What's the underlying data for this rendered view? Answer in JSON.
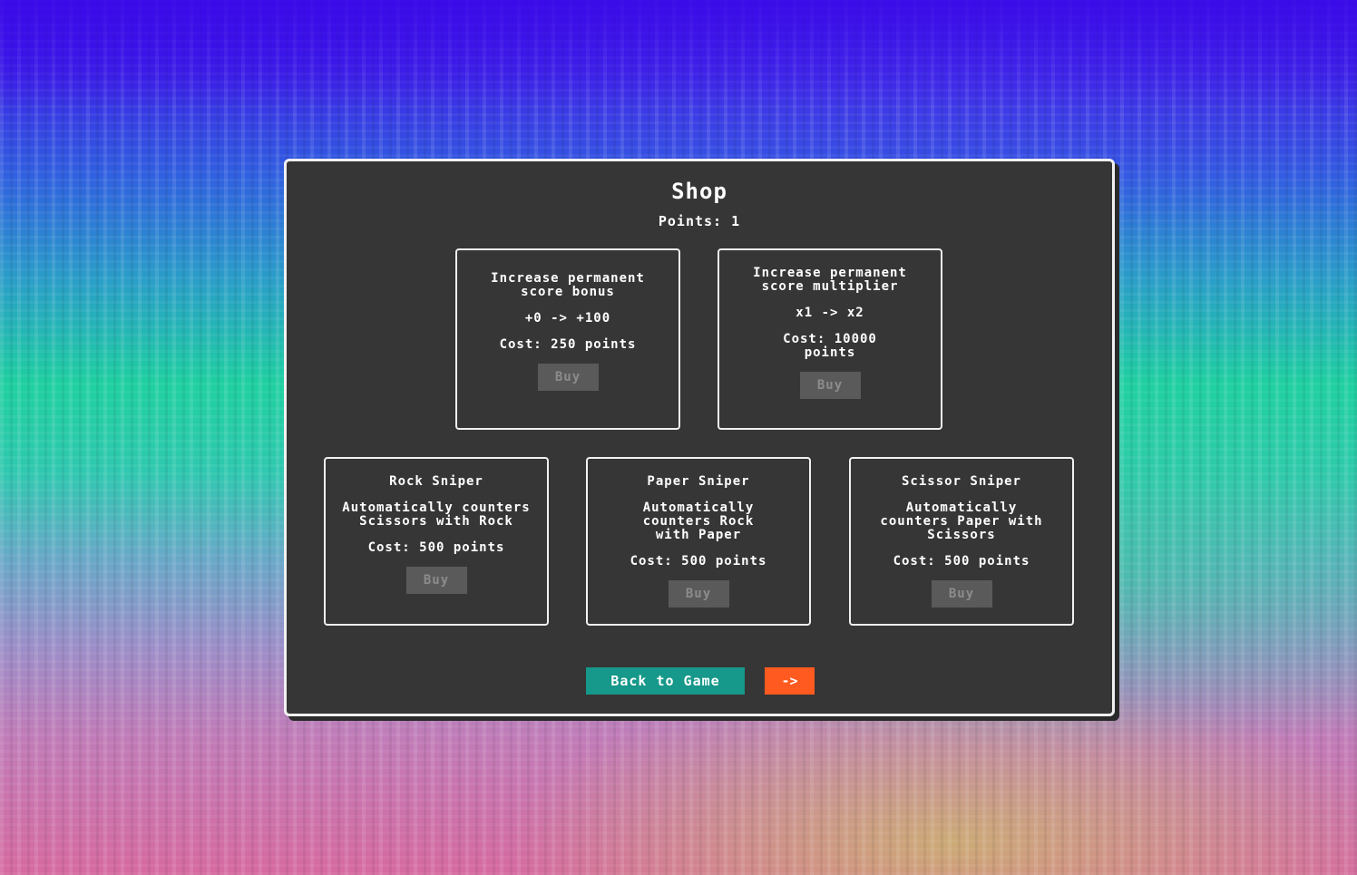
{
  "shop": {
    "title": "Shop",
    "points_label": "Points: 1"
  },
  "upgrades": [
    {
      "title": "Increase permanent score bonus",
      "change": "+0 -> +100",
      "cost": "Cost: 250 points",
      "buy_label": "Buy",
      "enabled": false
    },
    {
      "title": "Increase permanent score multiplier",
      "change": "x1 -> x2",
      "cost": "Cost: 10000 points",
      "buy_label": "Buy",
      "enabled": false
    },
    {
      "title": "Rock Sniper",
      "description": "Automatically counters Scissors with Rock",
      "cost": "Cost: 500 points",
      "buy_label": "Buy",
      "enabled": false
    },
    {
      "title": "Paper Sniper",
      "description": "Automatically counters Rock with Paper",
      "cost": "Cost: 500 points",
      "buy_label": "Buy",
      "enabled": false
    },
    {
      "title": "Scissor Sniper",
      "description": "Automatically counters Paper with Scissors",
      "cost": "Cost: 500 points",
      "buy_label": "Buy",
      "enabled": false
    }
  ],
  "footer": {
    "back_label": "Back to Game",
    "next_label": "->"
  },
  "colors": {
    "panel_bg": "#363636",
    "border": "#f0f0f0",
    "back_button": "#16988a",
    "next_button": "#ff5a1f",
    "disabled_button": "#5a5a5a"
  }
}
